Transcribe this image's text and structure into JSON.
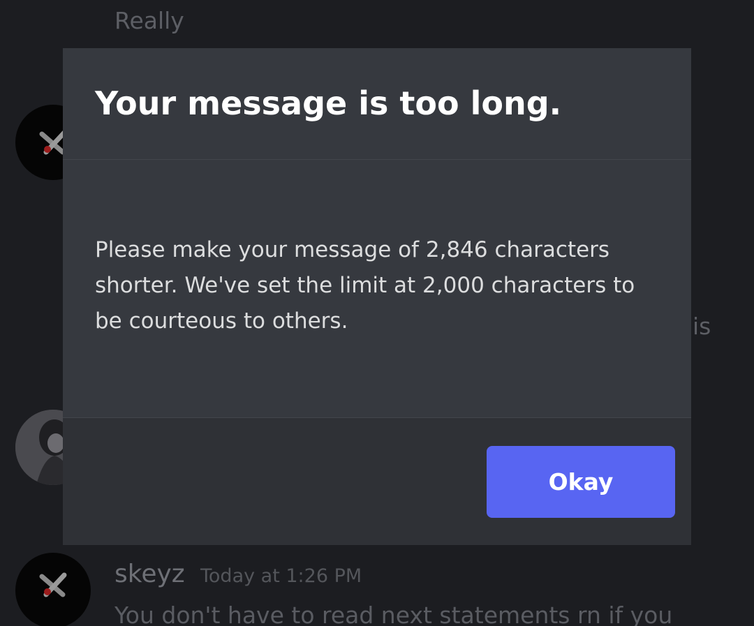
{
  "background_chat": {
    "top_message_text": "Really",
    "side_fragment_text": "is",
    "last_message": {
      "author": "skeyz",
      "timestamp": "Today at 1:26 PM",
      "text": "You don't have to read next statements rn if you"
    }
  },
  "modal": {
    "title": "Your message is too long.",
    "message": "Please make your message of 2,846 characters shorter. We've set the limit at 2,000 characters to be courteous to others.",
    "okay_label": "Okay"
  },
  "colors": {
    "accent": "#5865f2",
    "modal_background": "#36393f",
    "footer_background": "#2f3136"
  }
}
